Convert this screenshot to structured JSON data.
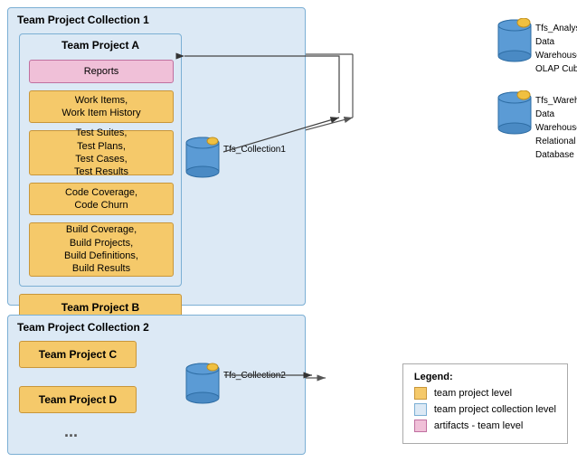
{
  "collection1": {
    "title": "Team Project Collection 1",
    "project_a": {
      "title": "Team Project A",
      "reports": "Reports",
      "work_items": "Work Items,\nWork Item History",
      "test": "Test Suites,\nTest Plans,\nTest Cases,\nTest Results",
      "code": "Code Coverage,\nCode Churn",
      "build": "Build Coverage,\nBuild Projects,\nBuild Definitions,\nBuild Results"
    },
    "project_b": "Team Project B",
    "dots": "..."
  },
  "collection2": {
    "title": "Team Project Collection 2",
    "project_c": "Team Project C",
    "project_d": "Team Project D",
    "dots": "..."
  },
  "cylinders": {
    "collection1_label": "Tfs_Collection1",
    "collection2_label": "Tfs_Collection2",
    "analysis_label": "Tfs_Analysis\nData Warehouse\nOLAP Cube",
    "warehouse_label": "Tfs_Warehouse\nData Warehouse\nRelational Database"
  },
  "legend": {
    "title": "Legend:",
    "items": [
      {
        "label": "team project level",
        "color": "#f5c96a",
        "border": "#c8963a"
      },
      {
        "label": "team project collection level",
        "color": "#dce9f5",
        "border": "#7bafd4"
      },
      {
        "label": "artifacts - team level",
        "color": "#f0c0d8",
        "border": "#c070a0"
      }
    ]
  }
}
